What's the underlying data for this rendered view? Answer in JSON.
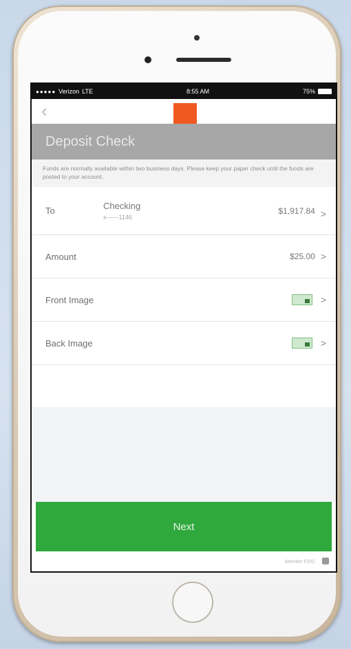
{
  "status_bar": {
    "signal": "●●●●●",
    "carrier": "Verizon",
    "network": "LTE",
    "time": "8:55 AM",
    "battery_text": "75%"
  },
  "nav": {
    "back_icon": "chevron-left-icon",
    "logo_color": "#ef5a22"
  },
  "page": {
    "title": "Deposit Check",
    "notice": "Funds are normally available within two business days. Please keep your paper check until the funds are posted to your account."
  },
  "rows": {
    "to": {
      "label": "To",
      "account_name": "Checking",
      "account_mask": "x------1146",
      "balance": "$1,917.84"
    },
    "amount": {
      "label": "Amount",
      "value": "$25.00"
    },
    "front": {
      "label": "Front Image",
      "icon": "check-image-icon"
    },
    "back": {
      "label": "Back Image",
      "icon": "check-image-icon"
    }
  },
  "chevron": ">",
  "next_button": {
    "label": "Next",
    "color": "#2fa83c"
  },
  "footer": {
    "text": "Member FDIC",
    "icon": "lock-icon"
  }
}
